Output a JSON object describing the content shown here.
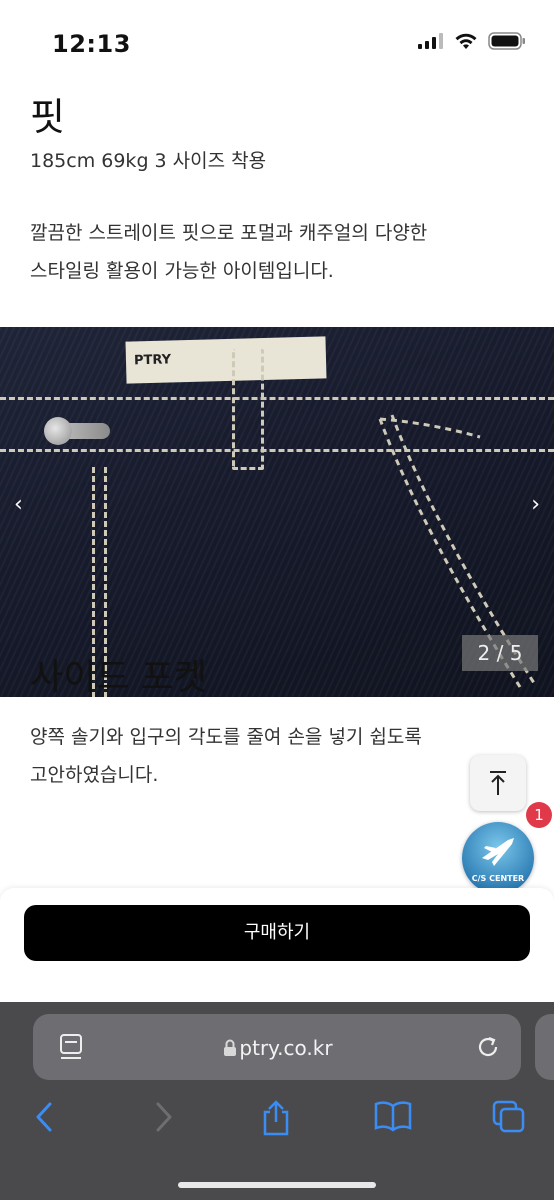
{
  "status": {
    "time": "12:13"
  },
  "section1": {
    "title": "핏",
    "subtitle": "185cm 69kg 3 사이즈 착용",
    "desc_line1": "깔끔한 스트레이트 핏으로 포멀과 캐주얼의 다양한",
    "desc_line2": "스타일링 활용이 가능한 아이템입니다."
  },
  "carousel": {
    "counter": "2 / 5",
    "prev": "‹",
    "next": "›",
    "label_text": "PTRY"
  },
  "section2": {
    "title": "사이드 포켓",
    "desc_line1": "양쪽 솔기와 입구의 각도를 줄여 손을 넣기 쉽도록",
    "desc_line2": "고안하였습니다."
  },
  "cs": {
    "label": "C/S CENTER",
    "badge": "1"
  },
  "buy": {
    "label": "구매하기"
  },
  "browser": {
    "url": "ptry.co.kr"
  },
  "colors": {
    "buy_button": "#000000",
    "badge": "#e03a4a",
    "safari_tint": "#3a8df5"
  }
}
